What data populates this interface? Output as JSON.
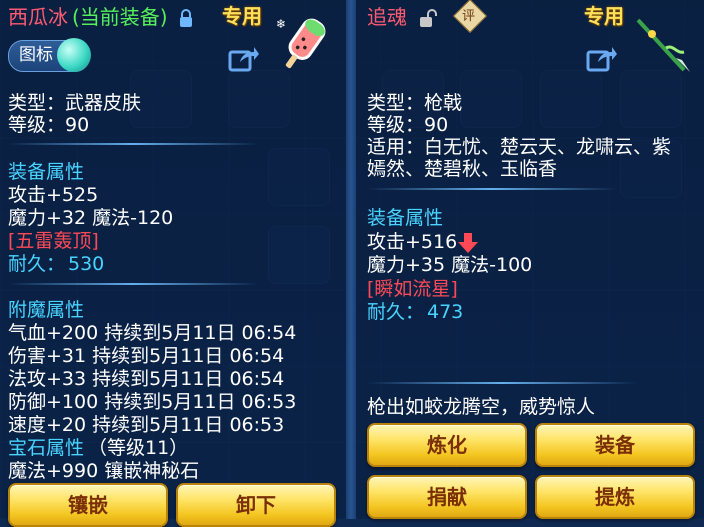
{
  "left_panel": {
    "name": "西瓜冰",
    "status": "(当前装备)",
    "special": "专用",
    "toggle_label": "图标",
    "type": "类型：武器皮肤",
    "level": "等级：90",
    "equip_header": "装备属性",
    "attack": "攻击+525",
    "magic": "魔力+32 魔法-120",
    "skill": "[五雷轰顶]",
    "durability_label": "耐久：",
    "durability_value": "530",
    "enchant_header": "附魔属性",
    "enchants": [
      "气血+200 持续到5月11日 06:54",
      "伤害+31 持续到5月11日 06:54",
      "法攻+33 持续到5月11日 06:54",
      "防御+100 持续到5月11日 06:53",
      "速度+20 持续到5月11日 06:53"
    ],
    "gem_header": "宝石属性",
    "gem_level": "（等级11）",
    "gem_attr": "魔法+990 镶嵌神秘石",
    "buttons": [
      "镶嵌",
      "卸下"
    ]
  },
  "right_panel": {
    "name": "追魂",
    "appraise": "评",
    "special": "专用",
    "type": "类型：枪戟",
    "level": "等级：90",
    "applicable_line1": "适用：白无忧、楚云天、龙啸云、紫",
    "applicable_line2": "嫣然、楚碧秋、玉临香",
    "equip_header": "装备属性",
    "attack": "攻击+516",
    "magic": "魔力+35 魔法-100",
    "skill": "[瞬如流星]",
    "durability_label": "耐久：",
    "durability_value": "473",
    "description": "枪出如蛟龙腾空，威势惊人",
    "buttons": [
      "炼化",
      "装备",
      "捐献",
      "提炼"
    ]
  },
  "colors": {
    "cyan": "#49d3ff",
    "red": "#ff4a55",
    "green": "#56f05a",
    "gold": "#ffd84a",
    "name_red": "#ff5a70"
  },
  "icons": [
    "lock-icon",
    "unlock-icon",
    "share-icon",
    "popsicle-item-icon",
    "spear-item-icon",
    "down-arrow-icon",
    "appraise-badge-icon"
  ]
}
